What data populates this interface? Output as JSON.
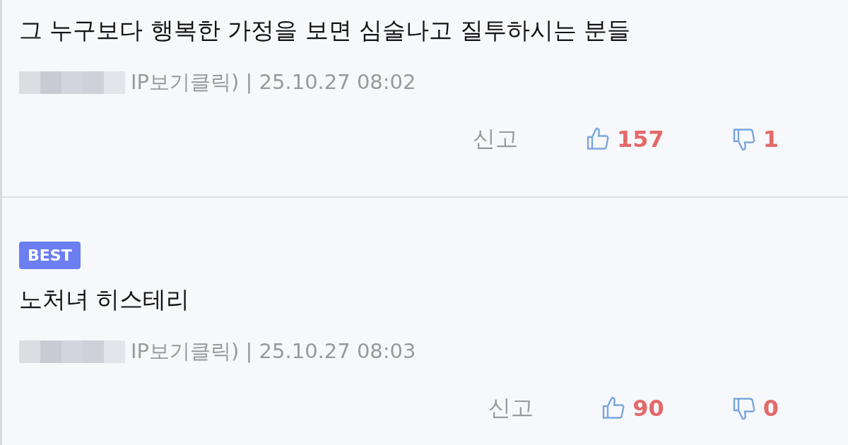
{
  "comments": [
    {
      "title": "그 누구보다 행복한 가정을 보면 심술나고 질투하시는 분들",
      "meta": "IP보기클릭) | 25.10.27 08:02",
      "report": "신고",
      "likes": "157",
      "dislikes": "1"
    },
    {
      "badge": "BEST",
      "title": "노처녀 히스테리",
      "meta": "IP보기클릭) | 25.10.27 08:03",
      "report": "신고",
      "likes": "90",
      "dislikes": "0"
    }
  ]
}
